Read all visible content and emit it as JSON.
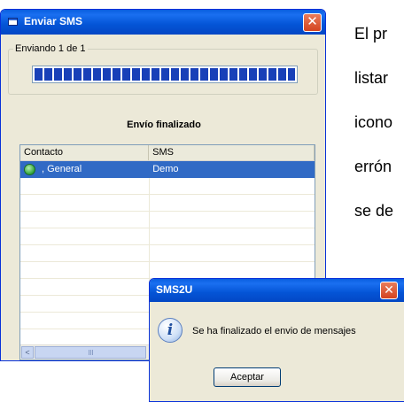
{
  "main_window": {
    "title": "Enviar SMS",
    "close_glyph": "✕",
    "group_label": "Enviando 1 de 1",
    "progress_fraction": 1.0,
    "status_text": "Envío finalizado",
    "list": {
      "columns": [
        "Contacto",
        "SMS"
      ],
      "rows": [
        {
          "contact": ", General",
          "sms": "Demo",
          "icon": "green-circle-icon",
          "selected": true
        }
      ],
      "scroll_left_glyph": "<"
    }
  },
  "background_text": {
    "lines": [
      "El pr",
      "listar",
      "icono",
      "errón",
      "se de"
    ]
  },
  "dialog": {
    "title": "SMS2U",
    "close_glyph": "✕",
    "icon": "information-icon",
    "icon_glyph": "i",
    "message": "Se ha finalizado el envio de mensajes",
    "ok_label": "Aceptar"
  },
  "colors": {
    "titlebar_blue": "#0454d6",
    "selection": "#316ac5",
    "window_face": "#ece9d8",
    "progress_block": "#1840b8",
    "close_red": "#d4431f"
  }
}
